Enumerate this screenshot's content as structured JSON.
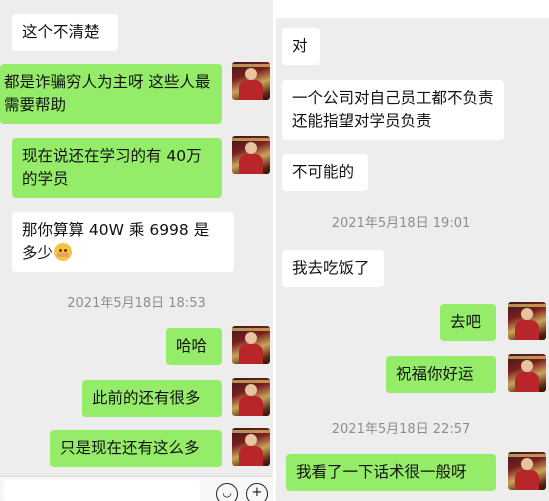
{
  "left_chat": {
    "messages": [
      {
        "side": "in",
        "text": "这个不清楚"
      },
      {
        "side": "out",
        "text": "都是诈骗穷人为主呀 这些人最需要帮助"
      },
      {
        "side": "out",
        "text": "现在说还在学习的有 40万的学员"
      },
      {
        "side": "in",
        "text": "那你算算 40W 乘 6998 是多少"
      },
      {
        "side": "out",
        "text": "哈哈"
      },
      {
        "side": "out",
        "text": "此前的还有很多"
      },
      {
        "side": "out",
        "text": "只是现在还有这么多"
      }
    ],
    "timestamp": "2021年5月18日 18:53",
    "emoji_name": "flushed-face-icon"
  },
  "right_chat": {
    "messages": [
      {
        "side": "in",
        "text": "对"
      },
      {
        "side": "in",
        "text": "一个公司对自己员工都不负责还能指望对学员负责"
      },
      {
        "side": "in",
        "text": "不可能的"
      },
      {
        "side": "in",
        "text": "我去吃饭了"
      },
      {
        "side": "out",
        "text": "去吧"
      },
      {
        "side": "out",
        "text": "祝福你好运"
      },
      {
        "side": "out",
        "text": "我看了一下话术很一般呀"
      }
    ],
    "timestamps": [
      "2021年5月18日 19:01",
      "2021年5月18日 22:57"
    ]
  },
  "colors": {
    "chat_background": "#ededed",
    "incoming_bubble": "#ffffff",
    "outgoing_bubble": "#95ec69",
    "timestamp_text": "#8e8e8e"
  },
  "input_bar": {
    "icons": [
      "emoji-icon",
      "plus-icon"
    ]
  }
}
